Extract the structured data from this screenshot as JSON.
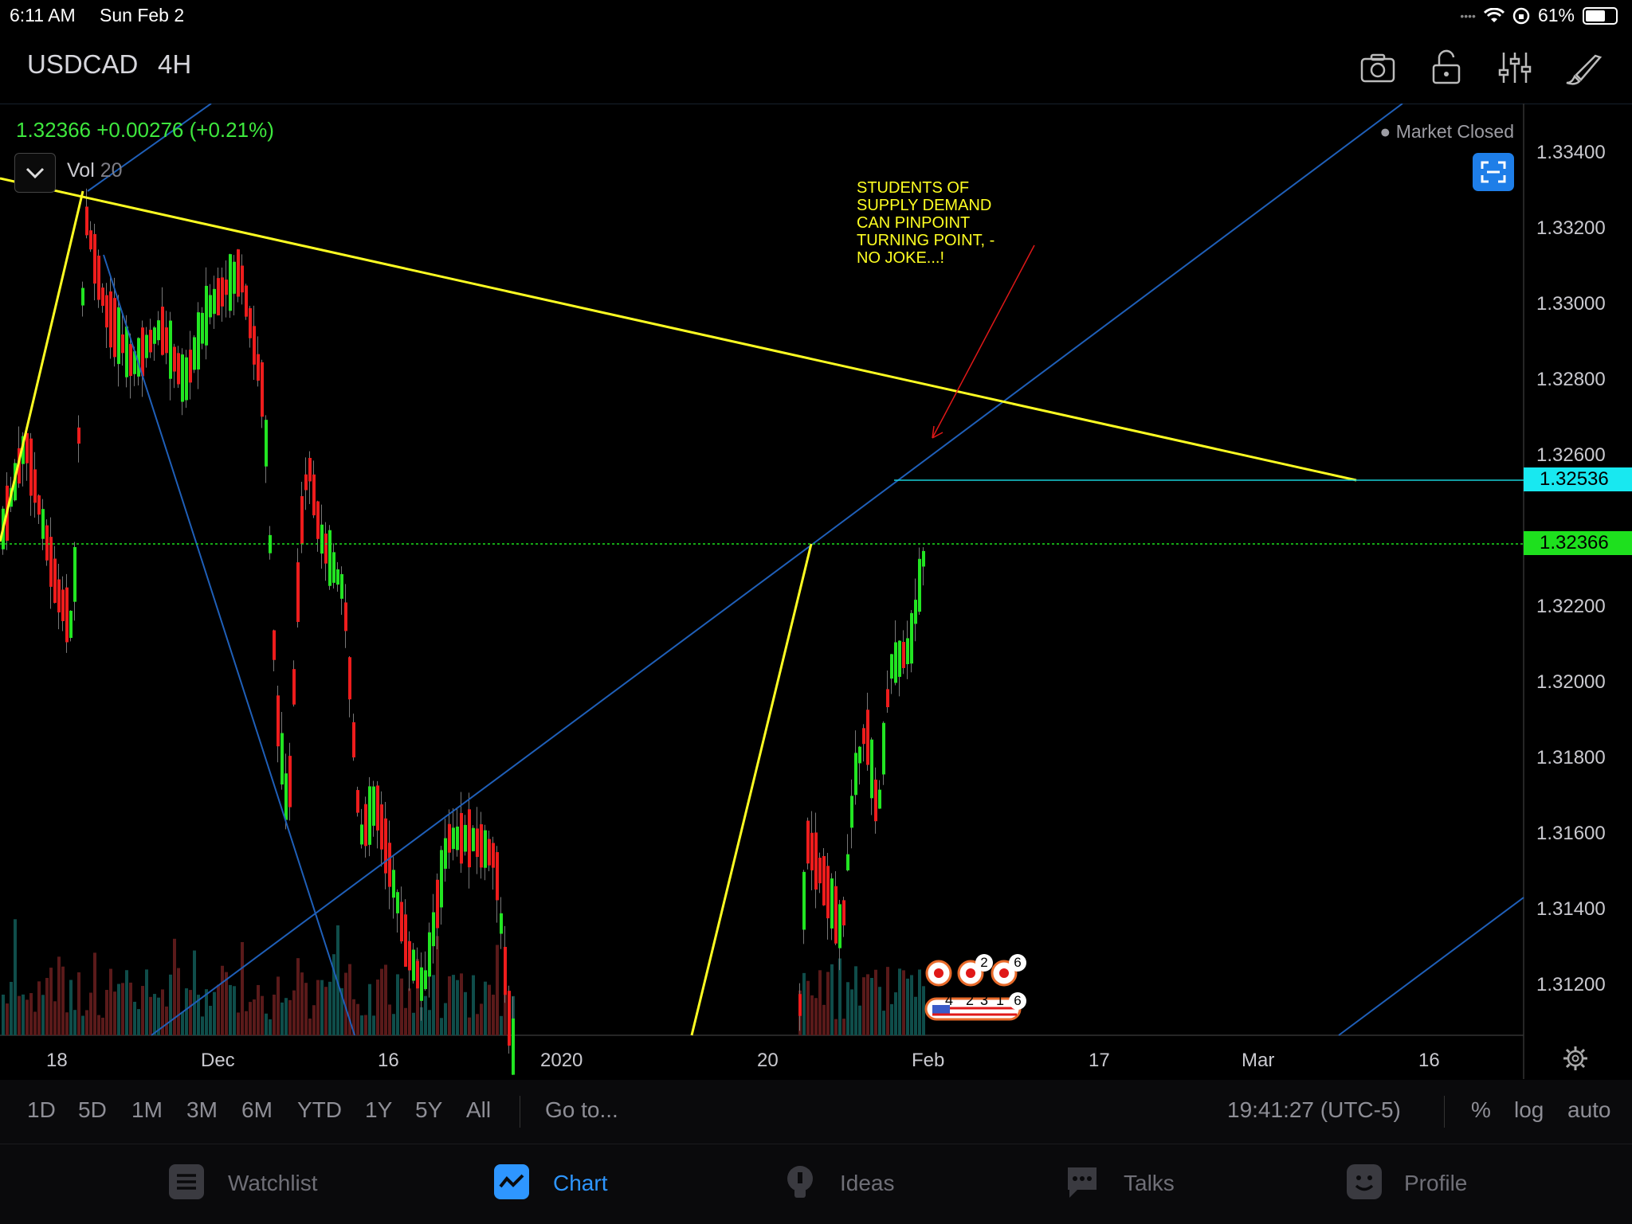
{
  "status_bar": {
    "time": "6:11 AM",
    "date": "Sun Feb 2",
    "battery": "61%"
  },
  "header": {
    "symbol": "USDCAD",
    "interval": "4H"
  },
  "chart": {
    "price": "1.32366",
    "change": "+0.00276",
    "change_pct": "(+0.21%)",
    "volume_label": "Vol",
    "volume_period": "20",
    "market_status": "Market Closed",
    "annotation_lines": [
      "STUDENTS OF",
      "SUPPLY DEMAND",
      "CAN PINPOINT",
      "TURNING POINT, -",
      "NO JOKE...!"
    ],
    "price_tags": {
      "high_line": "1.32536",
      "current": "1.32366"
    },
    "y_axis": [
      "1.33400",
      "1.33200",
      "1.33000",
      "1.32800",
      "1.32600",
      "1.32200",
      "1.32000",
      "1.31800",
      "1.31600",
      "1.31400",
      "1.31200"
    ],
    "x_axis": [
      "18",
      "Dec",
      "16",
      "2020",
      "20",
      "Feb",
      "17",
      "Mar",
      "16"
    ],
    "event_markers": {
      "row1": [
        "2",
        "6"
      ],
      "row2": [
        "4",
        "2",
        "3",
        "1",
        "6"
      ]
    },
    "colors": {
      "up": "#22e522",
      "down": "#ee1c1c",
      "trendline": "#ffff22",
      "channel": "#1f5fb8",
      "high_tag": "#18e8f0",
      "current_tag": "#1ee01e"
    }
  },
  "chart_data": {
    "type": "candlestick",
    "symbol": "USDCAD",
    "interval": "4H",
    "last": 1.32366,
    "high_marker": 1.32536,
    "ylim": [
      1.3108,
      1.3354
    ],
    "x_ticks": [
      "18",
      "Dec",
      "16",
      "2020",
      "20",
      "Feb",
      "17",
      "Mar",
      "16"
    ],
    "y_ticks": [
      1.334,
      1.332,
      1.33,
      1.328,
      1.326,
      1.322,
      1.32,
      1.318,
      1.316,
      1.314,
      1.312
    ]
  },
  "range_bar": {
    "ranges": [
      "1D",
      "5D",
      "1M",
      "3M",
      "6M",
      "YTD",
      "1Y",
      "5Y",
      "All"
    ],
    "goto": "Go to...",
    "clock": "19:41:27 (UTC-5)",
    "percent": "%",
    "log": "log",
    "auto": "auto"
  },
  "tabs": [
    {
      "label": "Watchlist",
      "icon": "list-icon"
    },
    {
      "label": "Chart",
      "icon": "chart-icon",
      "active": true
    },
    {
      "label": "Ideas",
      "icon": "lightbulb-icon"
    },
    {
      "label": "Talks",
      "icon": "chat-icon"
    },
    {
      "label": "Profile",
      "icon": "smiley-icon"
    }
  ]
}
